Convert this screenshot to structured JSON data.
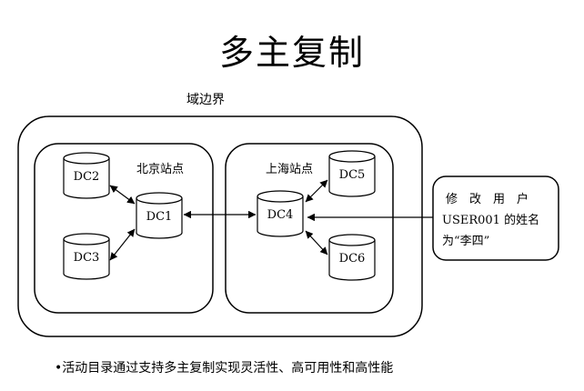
{
  "title": "多主复制",
  "domain_label": "域边界",
  "sites": {
    "beijing": "北京站点",
    "shanghai": "上海站点"
  },
  "dcs": {
    "dc1": "DC1",
    "dc2": "DC2",
    "dc3": "DC3",
    "dc4": "DC4",
    "dc5": "DC5",
    "dc6": "DC6"
  },
  "callout": {
    "line1": "修　改　用　户",
    "line2": "USER001 的姓名",
    "line3": "为“李四”"
  },
  "bullet": "•活动目录通过支持多主复制实现灵活性、高可用性和高性能"
}
